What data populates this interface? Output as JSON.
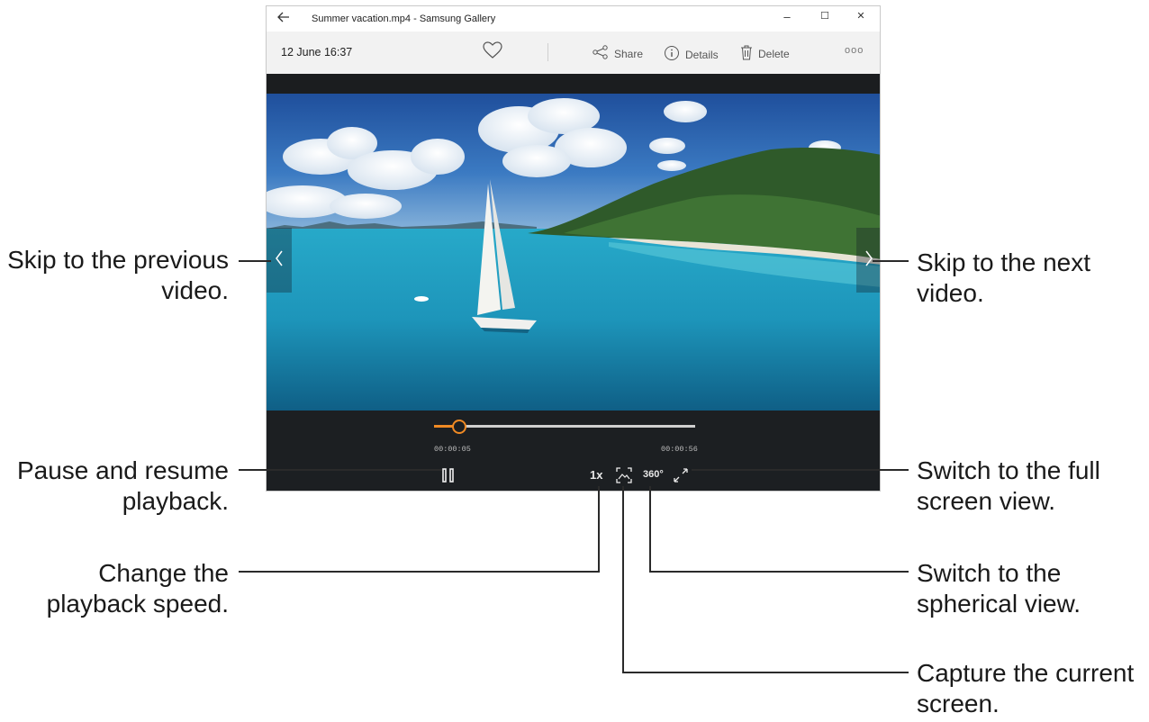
{
  "window": {
    "title": "Summer vacation.mp4 - Samsung Gallery",
    "back_icon": "arrow-left-icon",
    "controls": {
      "minimize": "–",
      "maximize": "☐",
      "close": "✕"
    }
  },
  "toolbar": {
    "date": "12 June 16:37",
    "favorite_icon": "heart-icon",
    "share_label": "Share",
    "details_label": "Details",
    "delete_label": "Delete",
    "more_label": "ooo"
  },
  "player": {
    "current_time": "00:00:05",
    "total_time": "00:00:56",
    "progress": 0.089,
    "speed_label": "1x",
    "spherical_label": "360°",
    "prev_icon": "chevron-left-icon",
    "next_icon": "chevron-right-icon",
    "pause_icon": "pause-icon",
    "capture_icon": "capture-icon",
    "fullscreen_icon": "expand-icon"
  },
  "callouts": {
    "prev": [
      "Skip to the previous",
      "video."
    ],
    "next": [
      "Skip to the next",
      "video."
    ],
    "pause": [
      "Pause and resume",
      "playback."
    ],
    "fullscreen": [
      "Switch to the full",
      "screen view."
    ],
    "speed": [
      "Change the",
      "playback speed."
    ],
    "spherical": [
      "Switch to the",
      "spherical view."
    ],
    "capture": [
      "Capture the current",
      "screen."
    ]
  },
  "colors": {
    "accent": "#f08a24",
    "sea": "#1ea8c8",
    "sky": "#2c63b0"
  }
}
